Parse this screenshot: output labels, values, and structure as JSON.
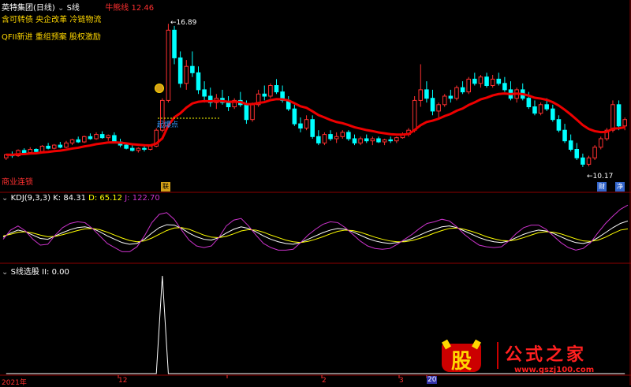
{
  "main_panel": {
    "stock_name": "英特集团(日线)",
    "indicator_name": "S线",
    "line_label": "牛熊线",
    "line_value": "12.46",
    "concept_tags_row1": "含可转债 央企改革 冷链物流",
    "concept_tags_row2": "QFII新进 重组预案 股权激励",
    "high_label": "16.89",
    "low_label": "10.17",
    "signal_label": "起爆点",
    "bottom_left_label": "商业连锁",
    "event_badges": [
      "联",
      "财",
      "净"
    ]
  },
  "kdj_panel": {
    "title": "KDJ(9,3,3)",
    "k_label": "K: 84.31",
    "d_label": "D: 65.12",
    "j_label": "J: 122.70"
  },
  "sline_panel": {
    "title": "S线选股",
    "value_label": "II: 0.00"
  },
  "time_axis": {
    "labels": [
      "2021年",
      "12",
      "2",
      "3",
      "20"
    ]
  },
  "watermark": {
    "logo_char": "股",
    "brand": "公式之家",
    "url": "www.gszj100.com"
  },
  "colors": {
    "up": "#ff3030",
    "down": "#00ffff",
    "bull_bear_line": "#ee0000",
    "k_line": "#ffffff",
    "d_line": "#ffff00",
    "j_line": "#cc33cc",
    "panel_border": "#8b0000",
    "brand_yellow": "#ffd700"
  },
  "chart_data": [
    {
      "type": "candlestick",
      "title": "英特集团(日线)",
      "ylim": [
        9.5,
        17.5
      ],
      "candles": [
        [
          10.6,
          10.8,
          10.5,
          10.75
        ],
        [
          10.75,
          10.9,
          10.6,
          10.7
        ],
        [
          10.7,
          11.0,
          10.65,
          10.95
        ],
        [
          10.95,
          11.05,
          10.8,
          10.85
        ],
        [
          10.85,
          11.1,
          10.8,
          11.0
        ],
        [
          11.0,
          11.05,
          10.85,
          10.9
        ],
        [
          10.9,
          11.2,
          10.9,
          11.15
        ],
        [
          11.15,
          11.3,
          11.0,
          11.05
        ],
        [
          11.05,
          11.25,
          11.0,
          11.2
        ],
        [
          11.2,
          11.35,
          11.05,
          11.1
        ],
        [
          11.1,
          11.4,
          11.05,
          11.3
        ],
        [
          11.3,
          11.5,
          11.2,
          11.45
        ],
        [
          11.45,
          11.6,
          11.3,
          11.35
        ],
        [
          11.35,
          11.65,
          11.3,
          11.6
        ],
        [
          11.6,
          11.75,
          11.45,
          11.5
        ],
        [
          11.5,
          11.8,
          11.45,
          11.7
        ],
        [
          11.7,
          11.85,
          11.5,
          11.55
        ],
        [
          11.55,
          11.7,
          11.4,
          11.65
        ],
        [
          11.65,
          11.8,
          11.3,
          11.35
        ],
        [
          11.35,
          11.5,
          11.1,
          11.2
        ],
        [
          11.2,
          11.3,
          11.0,
          11.05
        ],
        [
          11.05,
          11.2,
          10.9,
          10.95
        ],
        [
          10.95,
          11.1,
          10.85,
          11.05
        ],
        [
          11.05,
          11.15,
          10.9,
          11.0
        ],
        [
          11.0,
          11.2,
          10.95,
          11.15
        ],
        [
          11.15,
          12.0,
          11.1,
          11.9
        ],
        [
          11.9,
          13.4,
          11.8,
          13.3
        ],
        [
          13.3,
          16.9,
          13.2,
          16.6
        ],
        [
          16.6,
          16.8,
          15.0,
          15.3
        ],
        [
          15.3,
          15.6,
          13.9,
          14.1
        ],
        [
          14.1,
          15.2,
          13.8,
          14.9
        ],
        [
          14.9,
          15.6,
          14.4,
          14.6
        ],
        [
          14.6,
          14.9,
          13.6,
          13.8
        ],
        [
          13.8,
          14.2,
          13.2,
          13.5
        ],
        [
          13.5,
          13.9,
          13.0,
          13.2
        ],
        [
          13.2,
          13.6,
          12.9,
          13.4
        ],
        [
          13.4,
          13.8,
          13.1,
          13.2
        ],
        [
          13.2,
          13.5,
          12.8,
          13.0
        ],
        [
          13.0,
          13.4,
          12.9,
          13.3
        ],
        [
          13.3,
          13.7,
          13.0,
          13.1
        ],
        [
          13.1,
          13.3,
          12.2,
          12.4
        ],
        [
          12.4,
          13.2,
          12.3,
          13.1
        ],
        [
          13.1,
          13.8,
          13.0,
          13.6
        ],
        [
          13.6,
          14.0,
          13.3,
          13.5
        ],
        [
          13.5,
          14.1,
          13.4,
          14.0
        ],
        [
          14.0,
          14.3,
          13.6,
          13.7
        ],
        [
          13.7,
          14.0,
          13.2,
          13.3
        ],
        [
          13.3,
          13.5,
          12.8,
          12.9
        ],
        [
          12.9,
          13.1,
          12.1,
          12.2
        ],
        [
          12.2,
          12.5,
          11.8,
          12.0
        ],
        [
          12.0,
          12.6,
          11.9,
          12.4
        ],
        [
          12.4,
          12.6,
          11.5,
          11.6
        ],
        [
          11.6,
          11.9,
          11.2,
          11.3
        ],
        [
          11.3,
          11.8,
          11.2,
          11.7
        ],
        [
          11.7,
          11.9,
          11.4,
          11.5
        ],
        [
          11.5,
          11.8,
          11.3,
          11.6
        ],
        [
          11.6,
          11.9,
          11.5,
          11.8
        ],
        [
          11.8,
          11.9,
          11.4,
          11.5
        ],
        [
          11.5,
          11.7,
          11.2,
          11.3
        ],
        [
          11.3,
          11.6,
          11.2,
          11.5
        ],
        [
          11.5,
          11.7,
          11.3,
          11.4
        ],
        [
          11.4,
          11.6,
          11.2,
          11.5
        ],
        [
          11.5,
          11.6,
          11.3,
          11.35
        ],
        [
          11.35,
          11.5,
          11.2,
          11.45
        ],
        [
          11.45,
          11.6,
          11.3,
          11.4
        ],
        [
          11.4,
          11.6,
          11.3,
          11.55
        ],
        [
          11.55,
          11.8,
          11.5,
          11.7
        ],
        [
          11.7,
          12.0,
          11.6,
          11.9
        ],
        [
          11.9,
          13.5,
          11.8,
          13.3
        ],
        [
          13.3,
          15.0,
          13.0,
          13.8
        ],
        [
          13.8,
          14.2,
          13.2,
          13.4
        ],
        [
          13.4,
          13.8,
          12.6,
          12.8
        ],
        [
          12.8,
          13.2,
          12.5,
          13.1
        ],
        [
          13.1,
          13.6,
          13.0,
          13.5
        ],
        [
          13.5,
          13.8,
          13.2,
          13.4
        ],
        [
          13.4,
          14.0,
          13.3,
          13.9
        ],
        [
          13.9,
          14.2,
          13.6,
          13.7
        ],
        [
          13.7,
          14.4,
          13.6,
          14.3
        ],
        [
          14.3,
          14.6,
          14.0,
          14.1
        ],
        [
          14.1,
          14.5,
          13.9,
          14.4
        ],
        [
          14.4,
          14.6,
          13.9,
          14.0
        ],
        [
          14.0,
          14.5,
          13.9,
          14.3
        ],
        [
          14.3,
          14.6,
          14.0,
          14.1
        ],
        [
          14.1,
          14.4,
          13.7,
          13.8
        ],
        [
          13.8,
          14.2,
          13.3,
          13.4
        ],
        [
          13.4,
          13.9,
          13.2,
          13.8
        ],
        [
          13.8,
          14.1,
          13.3,
          13.4
        ],
        [
          13.4,
          13.7,
          12.9,
          13.0
        ],
        [
          13.0,
          13.3,
          12.6,
          12.7
        ],
        [
          12.7,
          13.2,
          12.6,
          13.1
        ],
        [
          13.1,
          13.4,
          12.8,
          12.9
        ],
        [
          12.9,
          13.1,
          12.3,
          12.4
        ],
        [
          12.4,
          12.6,
          11.8,
          11.9
        ],
        [
          11.9,
          12.2,
          11.3,
          11.4
        ],
        [
          11.4,
          11.7,
          10.9,
          11.0
        ],
        [
          11.0,
          11.3,
          10.5,
          10.6
        ],
        [
          10.6,
          10.8,
          10.17,
          10.3
        ],
        [
          10.3,
          10.7,
          10.2,
          10.6
        ],
        [
          10.6,
          11.2,
          10.5,
          11.1
        ],
        [
          11.1,
          11.6,
          11.0,
          11.5
        ],
        [
          11.5,
          12.0,
          11.4,
          11.9
        ],
        [
          11.9,
          13.3,
          11.8,
          13.1
        ],
        [
          13.1,
          13.3,
          11.9,
          12.1
        ],
        [
          12.1,
          12.5,
          11.9,
          12.4
        ]
      ]
    },
    {
      "type": "line",
      "title": "KDJ(9,3,3)",
      "ylim": [
        -10,
        130
      ],
      "series": [
        {
          "name": "K",
          "values": [
            45,
            55,
            62,
            58,
            50,
            42,
            40,
            48,
            56,
            63,
            68,
            70,
            66,
            58,
            48,
            40,
            32,
            28,
            30,
            40,
            55,
            68,
            75,
            74,
            66,
            55,
            46,
            40,
            38,
            44,
            55,
            64,
            70,
            66,
            58,
            48,
            40,
            34,
            30,
            28,
            32,
            40,
            48,
            56,
            62,
            66,
            64,
            58,
            50,
            42,
            36,
            32,
            30,
            32,
            36,
            42,
            50,
            58,
            64,
            70,
            72,
            68,
            60,
            52,
            44,
            38,
            34,
            32,
            36,
            44,
            52,
            58,
            62,
            60,
            54,
            46,
            38,
            32,
            30,
            34,
            44,
            56,
            68,
            78,
            84
          ]
        },
        {
          "name": "D",
          "values": [
            48,
            52,
            57,
            58,
            55,
            50,
            46,
            47,
            51,
            56,
            61,
            65,
            66,
            63,
            57,
            50,
            43,
            37,
            34,
            36,
            43,
            52,
            61,
            67,
            68,
            64,
            57,
            50,
            45,
            44,
            47,
            53,
            60,
            63,
            62,
            57,
            50,
            44,
            38,
            34,
            32,
            35,
            40,
            46,
            53,
            59,
            62,
            61,
            57,
            51,
            45,
            40,
            36,
            34,
            34,
            37,
            42,
            48,
            55,
            61,
            66,
            67,
            64,
            59,
            53,
            46,
            41,
            37,
            36,
            39,
            44,
            50,
            56,
            58,
            57,
            53,
            47,
            41,
            36,
            35,
            38,
            45,
            54,
            62,
            65
          ]
        },
        {
          "name": "J",
          "values": [
            40,
            62,
            72,
            60,
            40,
            26,
            28,
            50,
            68,
            78,
            82,
            80,
            66,
            48,
            30,
            20,
            10,
            10,
            22,
            48,
            80,
            100,
            104,
            88,
            62,
            38,
            24,
            20,
            24,
            44,
            72,
            86,
            90,
            72,
            50,
            30,
            20,
            14,
            14,
            16,
            32,
            50,
            64,
            76,
            82,
            80,
            68,
            52,
            36,
            24,
            18,
            16,
            18,
            28,
            40,
            52,
            66,
            78,
            82,
            88,
            84,
            70,
            52,
            38,
            26,
            22,
            20,
            22,
            36,
            54,
            68,
            74,
            74,
            64,
            48,
            32,
            20,
            14,
            18,
            32,
            56,
            78,
            96,
            112,
            122
          ]
        }
      ]
    },
    {
      "type": "line",
      "title": "S线选股",
      "ylim": [
        0,
        1
      ],
      "series": [
        {
          "name": "II",
          "values": [
            0,
            0,
            0,
            0,
            0,
            0,
            0,
            0,
            0,
            0,
            0,
            0,
            0,
            0,
            0,
            0,
            0,
            0,
            0,
            0,
            0,
            0,
            0,
            0,
            0,
            0,
            1,
            0,
            0,
            0,
            0,
            0,
            0,
            0,
            0,
            0,
            0,
            0,
            0,
            0,
            0,
            0,
            0,
            0,
            0,
            0,
            0,
            0,
            0,
            0,
            0,
            0,
            0,
            0,
            0,
            0,
            0,
            0,
            0,
            0,
            0,
            0,
            0,
            0,
            0,
            0,
            0,
            0,
            0,
            0,
            0,
            0,
            0,
            0,
            0,
            0,
            0,
            0,
            0,
            0,
            0,
            0,
            0,
            0,
            0,
            0,
            0,
            0,
            0,
            0,
            0,
            0,
            0,
            0,
            0,
            0,
            0,
            0,
            0,
            0,
            0,
            0,
            0,
            0
          ]
        }
      ]
    }
  ]
}
